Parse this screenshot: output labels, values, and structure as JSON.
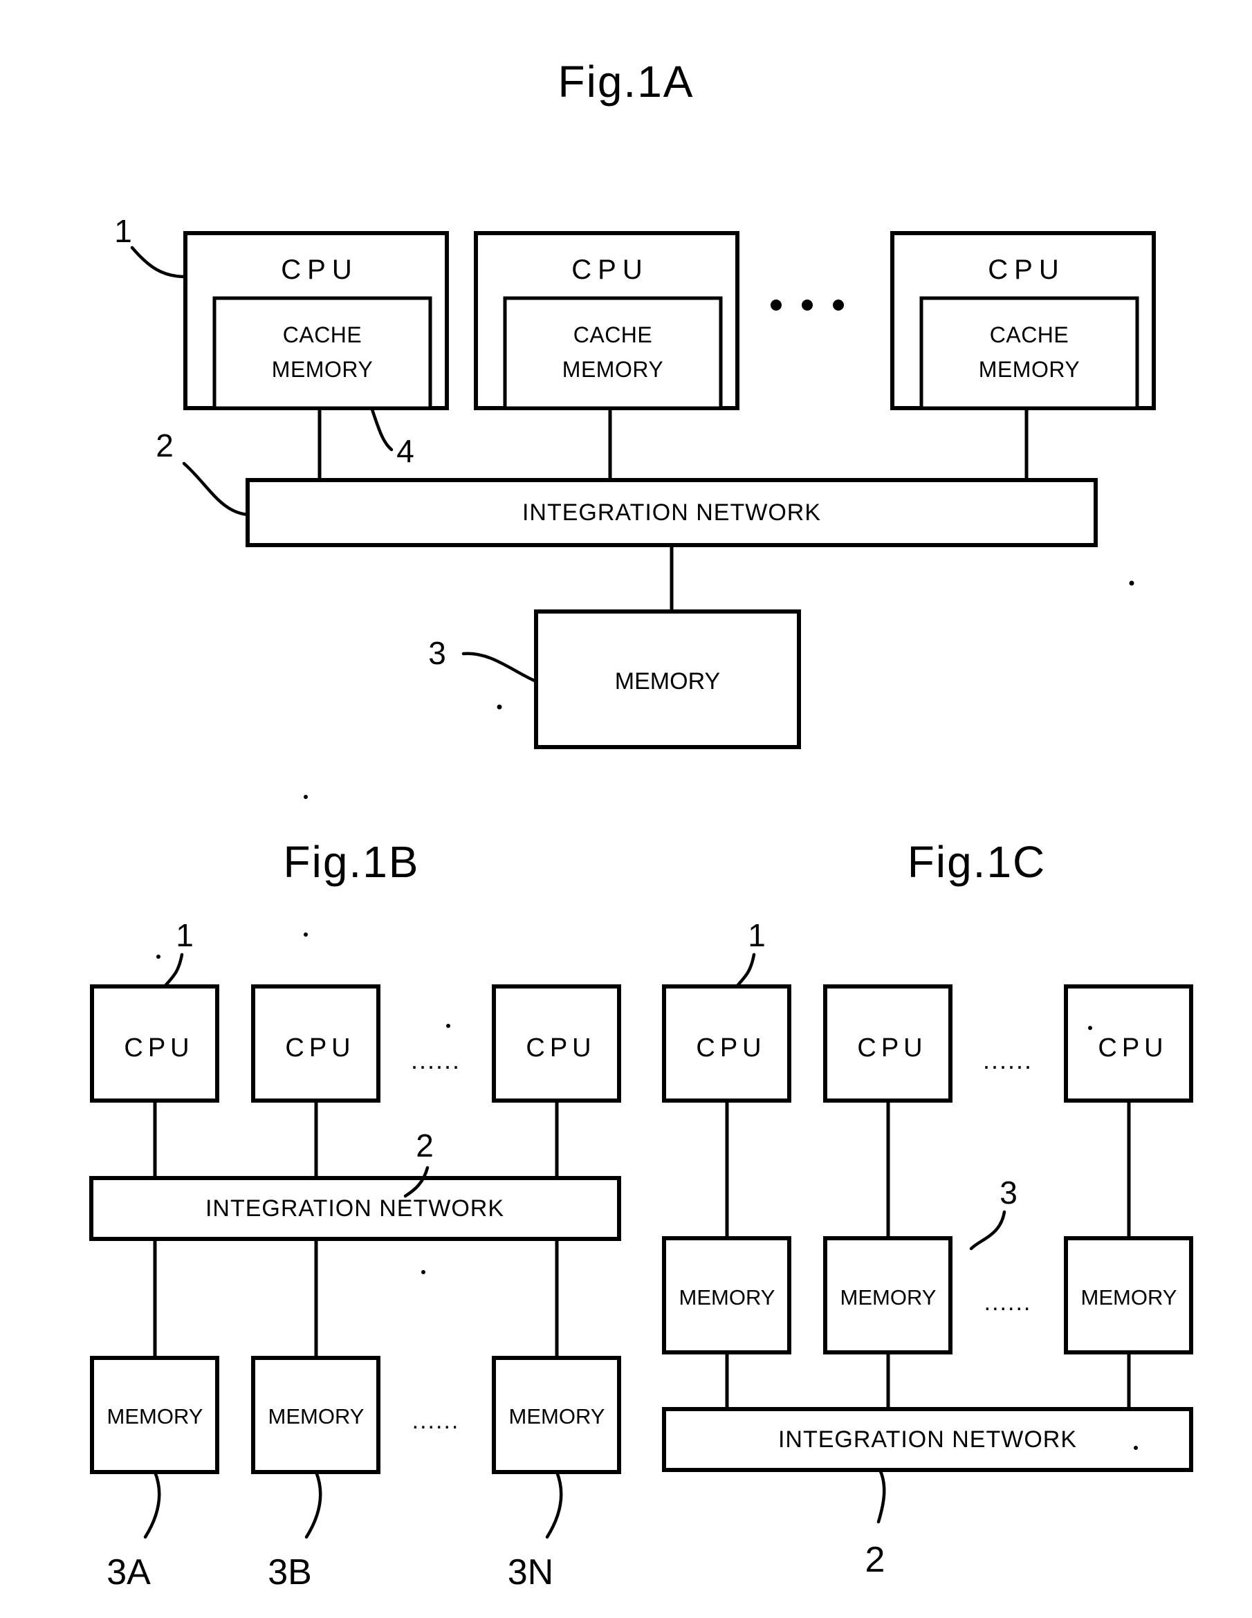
{
  "document": {
    "kind": "patent-figure-sheet",
    "figures": [
      "Fig.1A",
      "Fig.1B",
      "Fig.1C"
    ]
  },
  "fig1a": {
    "title": "Fig.1A",
    "cpus": [
      {
        "label": "CPU",
        "cache_line1": "CACHE",
        "cache_line2": "MEMORY"
      },
      {
        "label": "CPU",
        "cache_line1": "CACHE",
        "cache_line2": "MEMORY"
      },
      {
        "label": "CPU",
        "cache_line1": "CACHE",
        "cache_line2": "MEMORY"
      }
    ],
    "ellipsis": "...",
    "network_label": "INTEGRATION NETWORK",
    "memory_label": "MEMORY",
    "refs": {
      "cpu": "1",
      "network": "2",
      "memory": "3",
      "cache": "4"
    }
  },
  "fig1b": {
    "title": "Fig.1B",
    "cpus": [
      "CPU",
      "CPU",
      "CPU"
    ],
    "cpu_ellipsis": "......",
    "network_label": "INTEGRATION NETWORK",
    "memories": [
      "MEMORY",
      "MEMORY",
      "MEMORY"
    ],
    "memory_ellipsis": "......",
    "refs": {
      "cpu": "1",
      "network": "2",
      "memory_a": "3A",
      "memory_b": "3B",
      "memory_n": "3N"
    }
  },
  "fig1c": {
    "title": "Fig.1C",
    "cpus": [
      "CPU",
      "CPU",
      "CPU"
    ],
    "cpu_ellipsis": "......",
    "memories": [
      "MEMORY",
      "MEMORY",
      "MEMORY"
    ],
    "memory_ellipsis": "......",
    "network_label": "INTEGRATION NETWORK",
    "refs": {
      "cpu": "1",
      "memory": "3",
      "network": "2"
    }
  },
  "colors": {
    "ink": "#000000",
    "paper": "#ffffff"
  }
}
